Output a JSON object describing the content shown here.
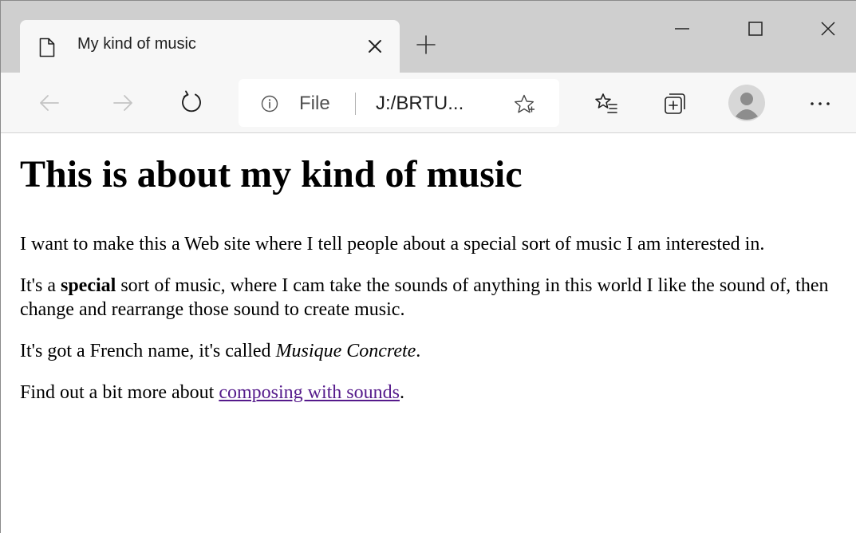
{
  "browser": {
    "tab_title": "My kind of music",
    "address_label": "File",
    "address_url": "J:/BRTU...",
    "icons": {
      "tab": "document-icon",
      "close_tab": "close-icon",
      "new_tab": "plus-icon",
      "back": "arrow-left-icon",
      "forward": "arrow-right-icon",
      "refresh": "refresh-icon",
      "info": "info-icon",
      "favorite": "star-icon",
      "favorites": "favorites-icon",
      "collections": "collections-icon",
      "profile": "avatar",
      "menu": "more-icon"
    }
  },
  "page": {
    "heading": "This is about my kind of music",
    "p1": "I want to make this a Web site where I tell people about a special sort of music I am interested in.",
    "p2": {
      "before": "It's a ",
      "bold": "special",
      "after": " sort of music, where I cam take the sounds of anything in this world I like the sound of, then change and rearrange those sound to create music."
    },
    "p3": {
      "before": "It's got a French name, it's called ",
      "italic": "Musique Concrete",
      "after": "."
    },
    "p4": {
      "before": "Find out a bit more about ",
      "link": "composing with sounds",
      "after": "."
    }
  },
  "colors": {
    "titlebar_bg": "#cfcfcf",
    "toolbar_bg": "#f7f7f7",
    "link_visited": "#551a8b"
  }
}
